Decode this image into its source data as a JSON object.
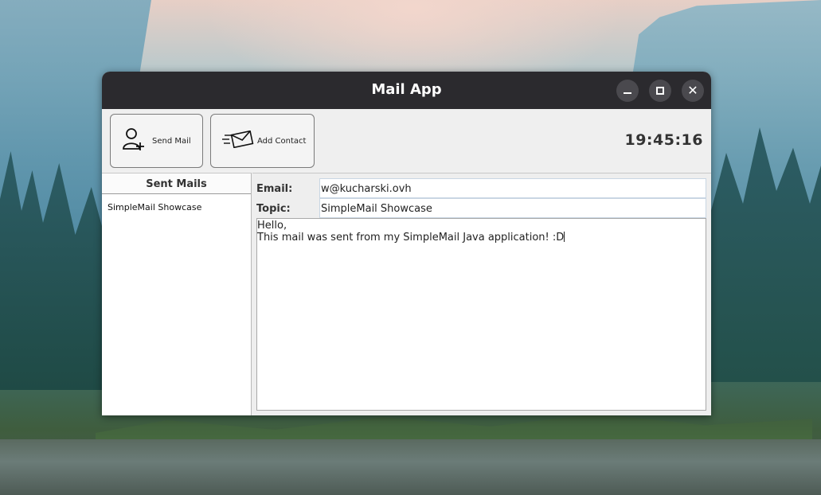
{
  "window": {
    "title": "Mail App",
    "controls": {
      "minimize": "minimize-icon",
      "maximize": "maximize-icon",
      "close": "close-icon"
    }
  },
  "toolbar": {
    "send_mail_label": "Send Mail",
    "add_contact_label": "Add Contact",
    "clock": "19:45:16"
  },
  "sidebar": {
    "title": "Sent Mails",
    "items": [
      {
        "label": "SimpleMail Showcase"
      }
    ]
  },
  "compose": {
    "email_label": "Email:",
    "email_value": "w@kucharski.ovh",
    "topic_label": "Topic:",
    "topic_value": "SimpleMail Showcase",
    "body_line1": "Hello,",
    "body_line2": "This mail was sent from my SimpleMail Java application! :D"
  },
  "colors": {
    "titlebar": "#2b2a2e",
    "window_bg": "#eeeeee",
    "field_border": "#c9d6e3"
  }
}
